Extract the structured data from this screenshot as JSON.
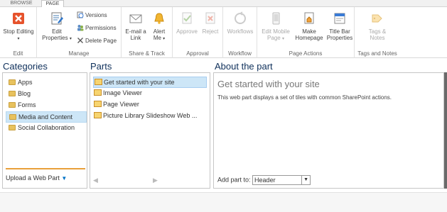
{
  "tabs": {
    "browse": "BROWSE",
    "page": "PAGE"
  },
  "ribbon": {
    "edit": {
      "group": "Edit",
      "stop_editing": "Stop Editing"
    },
    "manage": {
      "group": "Manage",
      "edit_properties_1": "Edit",
      "edit_properties_2": "Properties",
      "versions": "Versions",
      "permissions": "Permissions",
      "delete_page": "Delete Page"
    },
    "share": {
      "group": "Share & Track",
      "email_1": "E-mail a",
      "email_2": "Link",
      "alert_1": "Alert",
      "alert_2": "Me"
    },
    "approval": {
      "group": "Approval",
      "approve": "Approve",
      "reject": "Reject"
    },
    "workflow": {
      "group": "Workflow",
      "workflows": "Workflows"
    },
    "page_actions": {
      "group": "Page Actions",
      "edit_mobile_1": "Edit Mobile",
      "edit_mobile_2": "Page",
      "make_home_1": "Make",
      "make_home_2": "Homepage",
      "title_bar_1": "Title Bar",
      "title_bar_2": "Properties"
    },
    "tags": {
      "group": "Tags and Notes",
      "tags_1": "Tags &",
      "tags_2": "Notes"
    }
  },
  "categories": {
    "title": "Categories",
    "items": [
      "Apps",
      "Blog",
      "Forms",
      "Media and Content",
      "Social Collaboration"
    ],
    "upload": "Upload a Web Part"
  },
  "parts": {
    "title": "Parts",
    "items": [
      "Get started with your site",
      "Image Viewer",
      "Page Viewer",
      "Picture Library Slideshow Web ..."
    ]
  },
  "about": {
    "title": "About the part",
    "part_title": "Get started with your site",
    "description": "This web part displays a set of tiles with common SharePoint actions.",
    "add_part_label": "Add part to:",
    "zone_value": "Header"
  },
  "colors": {
    "accent": "#0072c6",
    "heading": "#0e2f5a",
    "selection": "#cde6f7",
    "upload_border": "#e9a03a",
    "stop_icon": "#e64a19"
  }
}
